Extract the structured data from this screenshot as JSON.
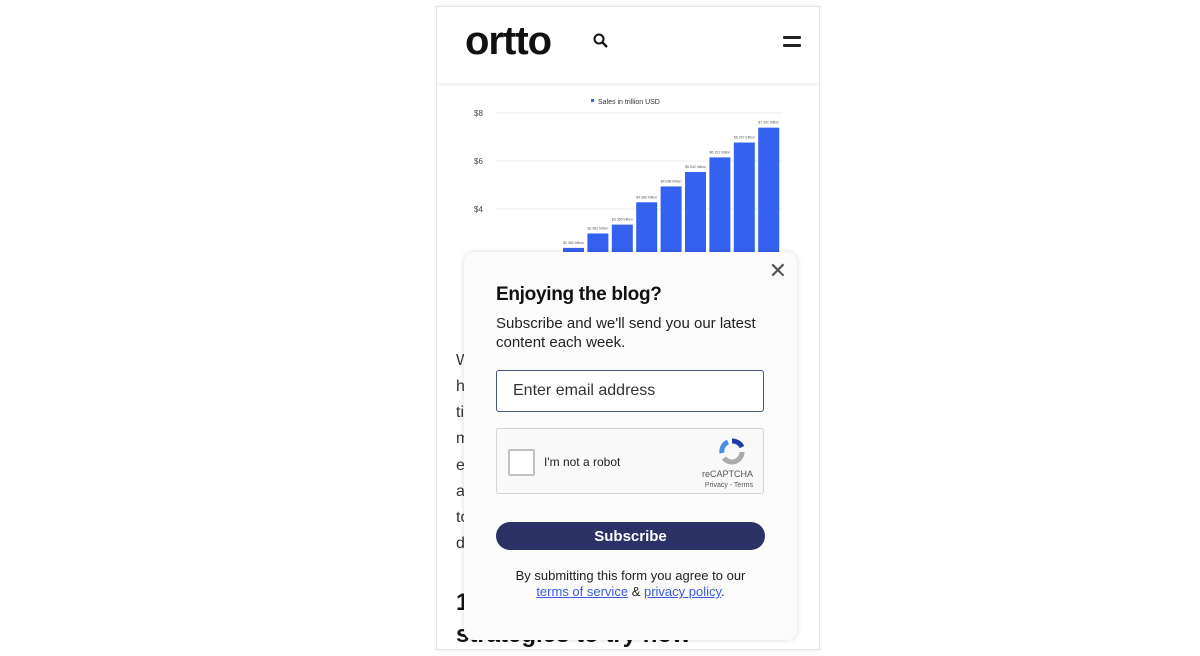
{
  "header": {
    "logo": "ortto",
    "icons": [
      "search-icon",
      "hamburger-menu-icon"
    ]
  },
  "chart_data": {
    "type": "bar",
    "legend": "Sales in trillion USD",
    "legend_position": "top",
    "y_ticks": [
      "$4",
      "$6",
      "$8"
    ],
    "ylim": [
      0,
      8
    ],
    "grid": true,
    "color": "#3461f0",
    "values": [
      2.38,
      2.98,
      3.35,
      4.28,
      4.94,
      5.54,
      6.15,
      6.77,
      7.39
    ],
    "data_labels": [
      "$2.382 trillion",
      "$2.982 trillion",
      "$3.354 trillion",
      "$4.280 trillion",
      "$4.938 trillion",
      "$5.542 trillion",
      "$6.151 trillion",
      "$6.767 trillion",
      "$7.391 trillion"
    ]
  },
  "article": {
    "para_fragments": [
      "W",
      "h",
      "ti",
      "m",
      "e",
      "a",
      "to",
      "d"
    ],
    "heading_fragments": [
      "1",
      "strategies to try now"
    ]
  },
  "popup": {
    "title": "Enjoying the blog?",
    "subtitle": "Subscribe and we'll send you our latest content each week.",
    "email_placeholder": "Enter email address",
    "captcha_label": "I'm not a robot",
    "captcha_brand": "reCAPTCHA",
    "captcha_links": "Privacy - Terms",
    "subscribe_label": "Subscribe",
    "legal_prefix": "By submitting this form you agree to our",
    "terms_link": "terms of service",
    "amp": "&",
    "privacy_link": "privacy policy",
    "period": ".",
    "close_icon": "close-icon",
    "button_color": "#2d3266"
  }
}
